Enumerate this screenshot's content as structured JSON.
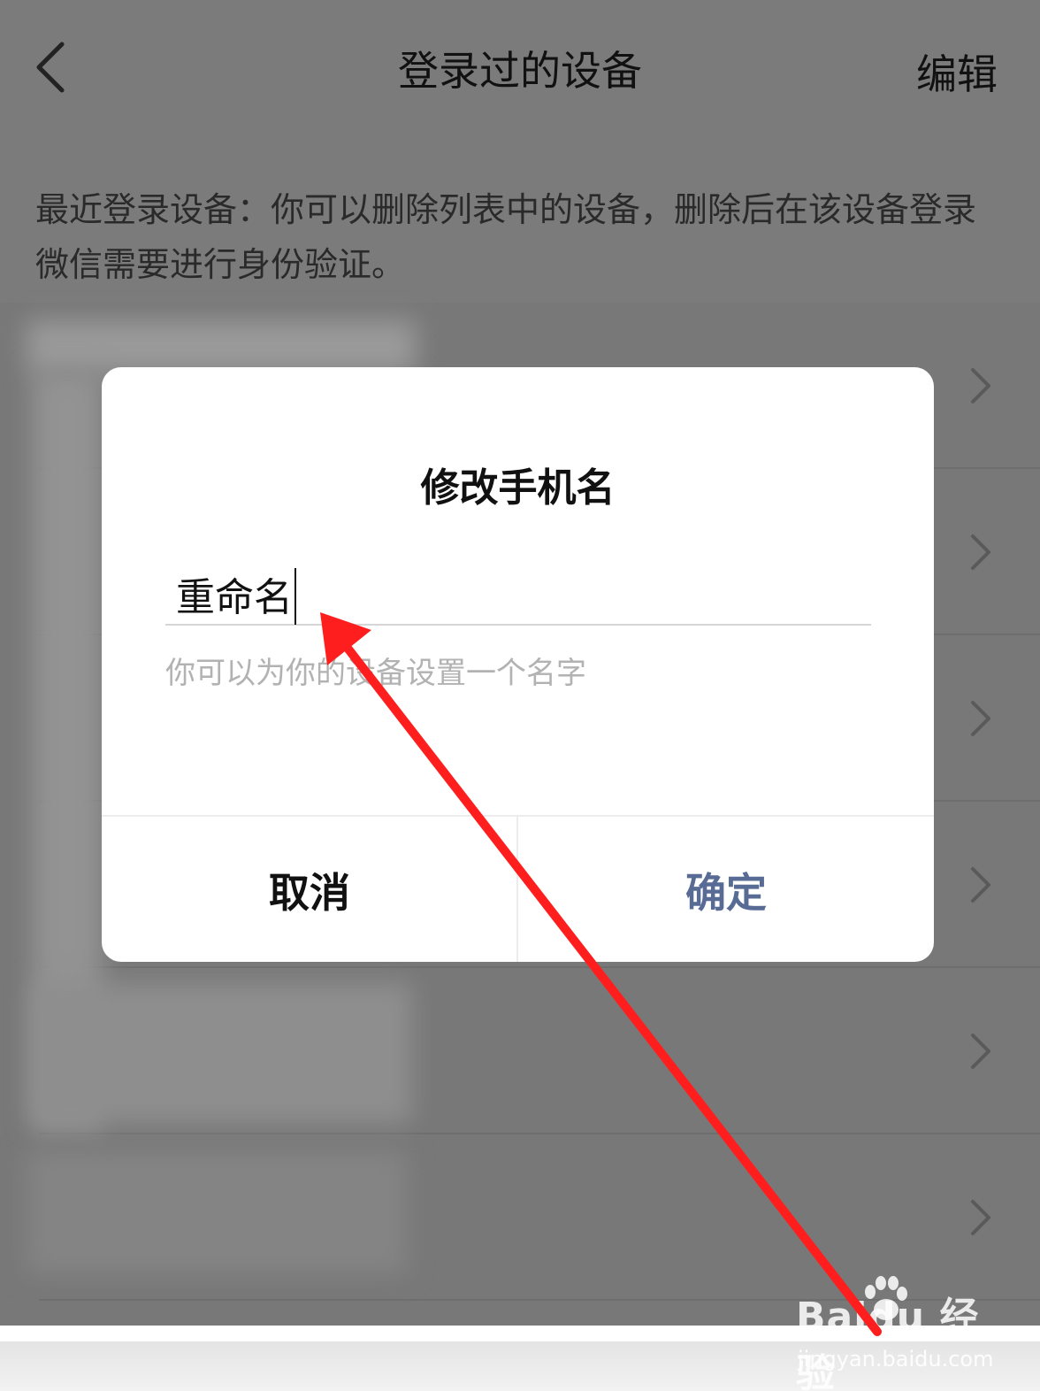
{
  "header": {
    "title": "登录过的设备",
    "edit_label": "编辑"
  },
  "description": "最近登录设备：你可以删除列表中的设备，删除后在该设备登录微信需要进行身份验证。",
  "device_rows_count": 6,
  "dialog": {
    "title": "修改手机名",
    "input_value": "重命名",
    "hint": "你可以为你的设备设置一个名字",
    "cancel_label": "取消",
    "confirm_label": "确定"
  },
  "watermark": {
    "brand": "Baidu 经验",
    "url": "jingyan.baidu.com"
  },
  "colors": {
    "confirm_text": "#576b95",
    "annotation_arrow": "#ff1e1e",
    "overlay_bg": "#7b7b7b"
  },
  "icons": [
    "back-chevron-icon",
    "chevron-right-icon",
    "baidu-paw-icon"
  ]
}
